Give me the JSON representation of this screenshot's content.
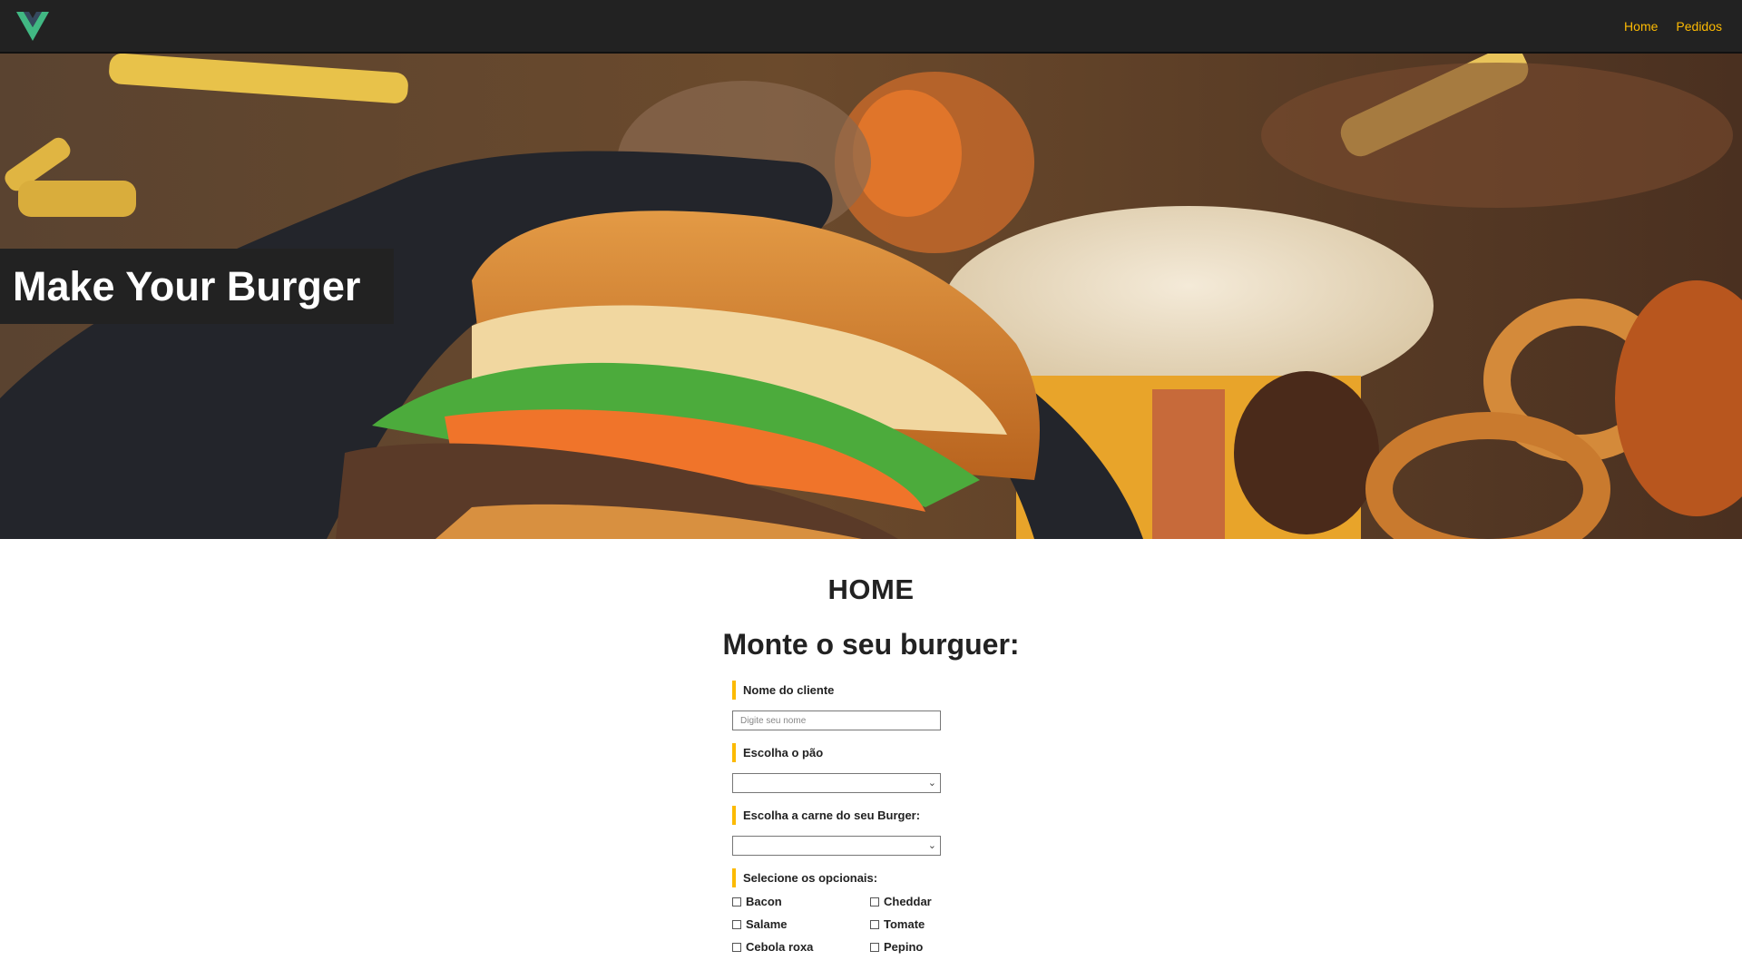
{
  "navbar": {
    "logo_icon": "vue-logo-icon",
    "links": [
      {
        "label": "Home"
      },
      {
        "label": "Pedidos"
      }
    ],
    "link_color": "#fcba03",
    "background": "#222222"
  },
  "hero": {
    "title": "Make Your Burger"
  },
  "main": {
    "page_title": "HOME",
    "form_title": "Monte o seu burguer:"
  },
  "form": {
    "name_label": "Nome do cliente",
    "name_placeholder": "Digite seu nome",
    "name_value": "",
    "bread_label": "Escolha o pão",
    "bread_selected": "",
    "meat_label": "Escolha a carne do seu Burger:",
    "meat_selected": "",
    "optionals_label": "Selecione os opcionais:",
    "optionals": [
      {
        "label": "Bacon",
        "checked": false
      },
      {
        "label": "Cheddar",
        "checked": false
      },
      {
        "label": "Salame",
        "checked": false
      },
      {
        "label": "Tomate",
        "checked": false
      },
      {
        "label": "Cebola roxa",
        "checked": false
      },
      {
        "label": "Pepino",
        "checked": false
      }
    ],
    "accent": "#fcba03"
  }
}
